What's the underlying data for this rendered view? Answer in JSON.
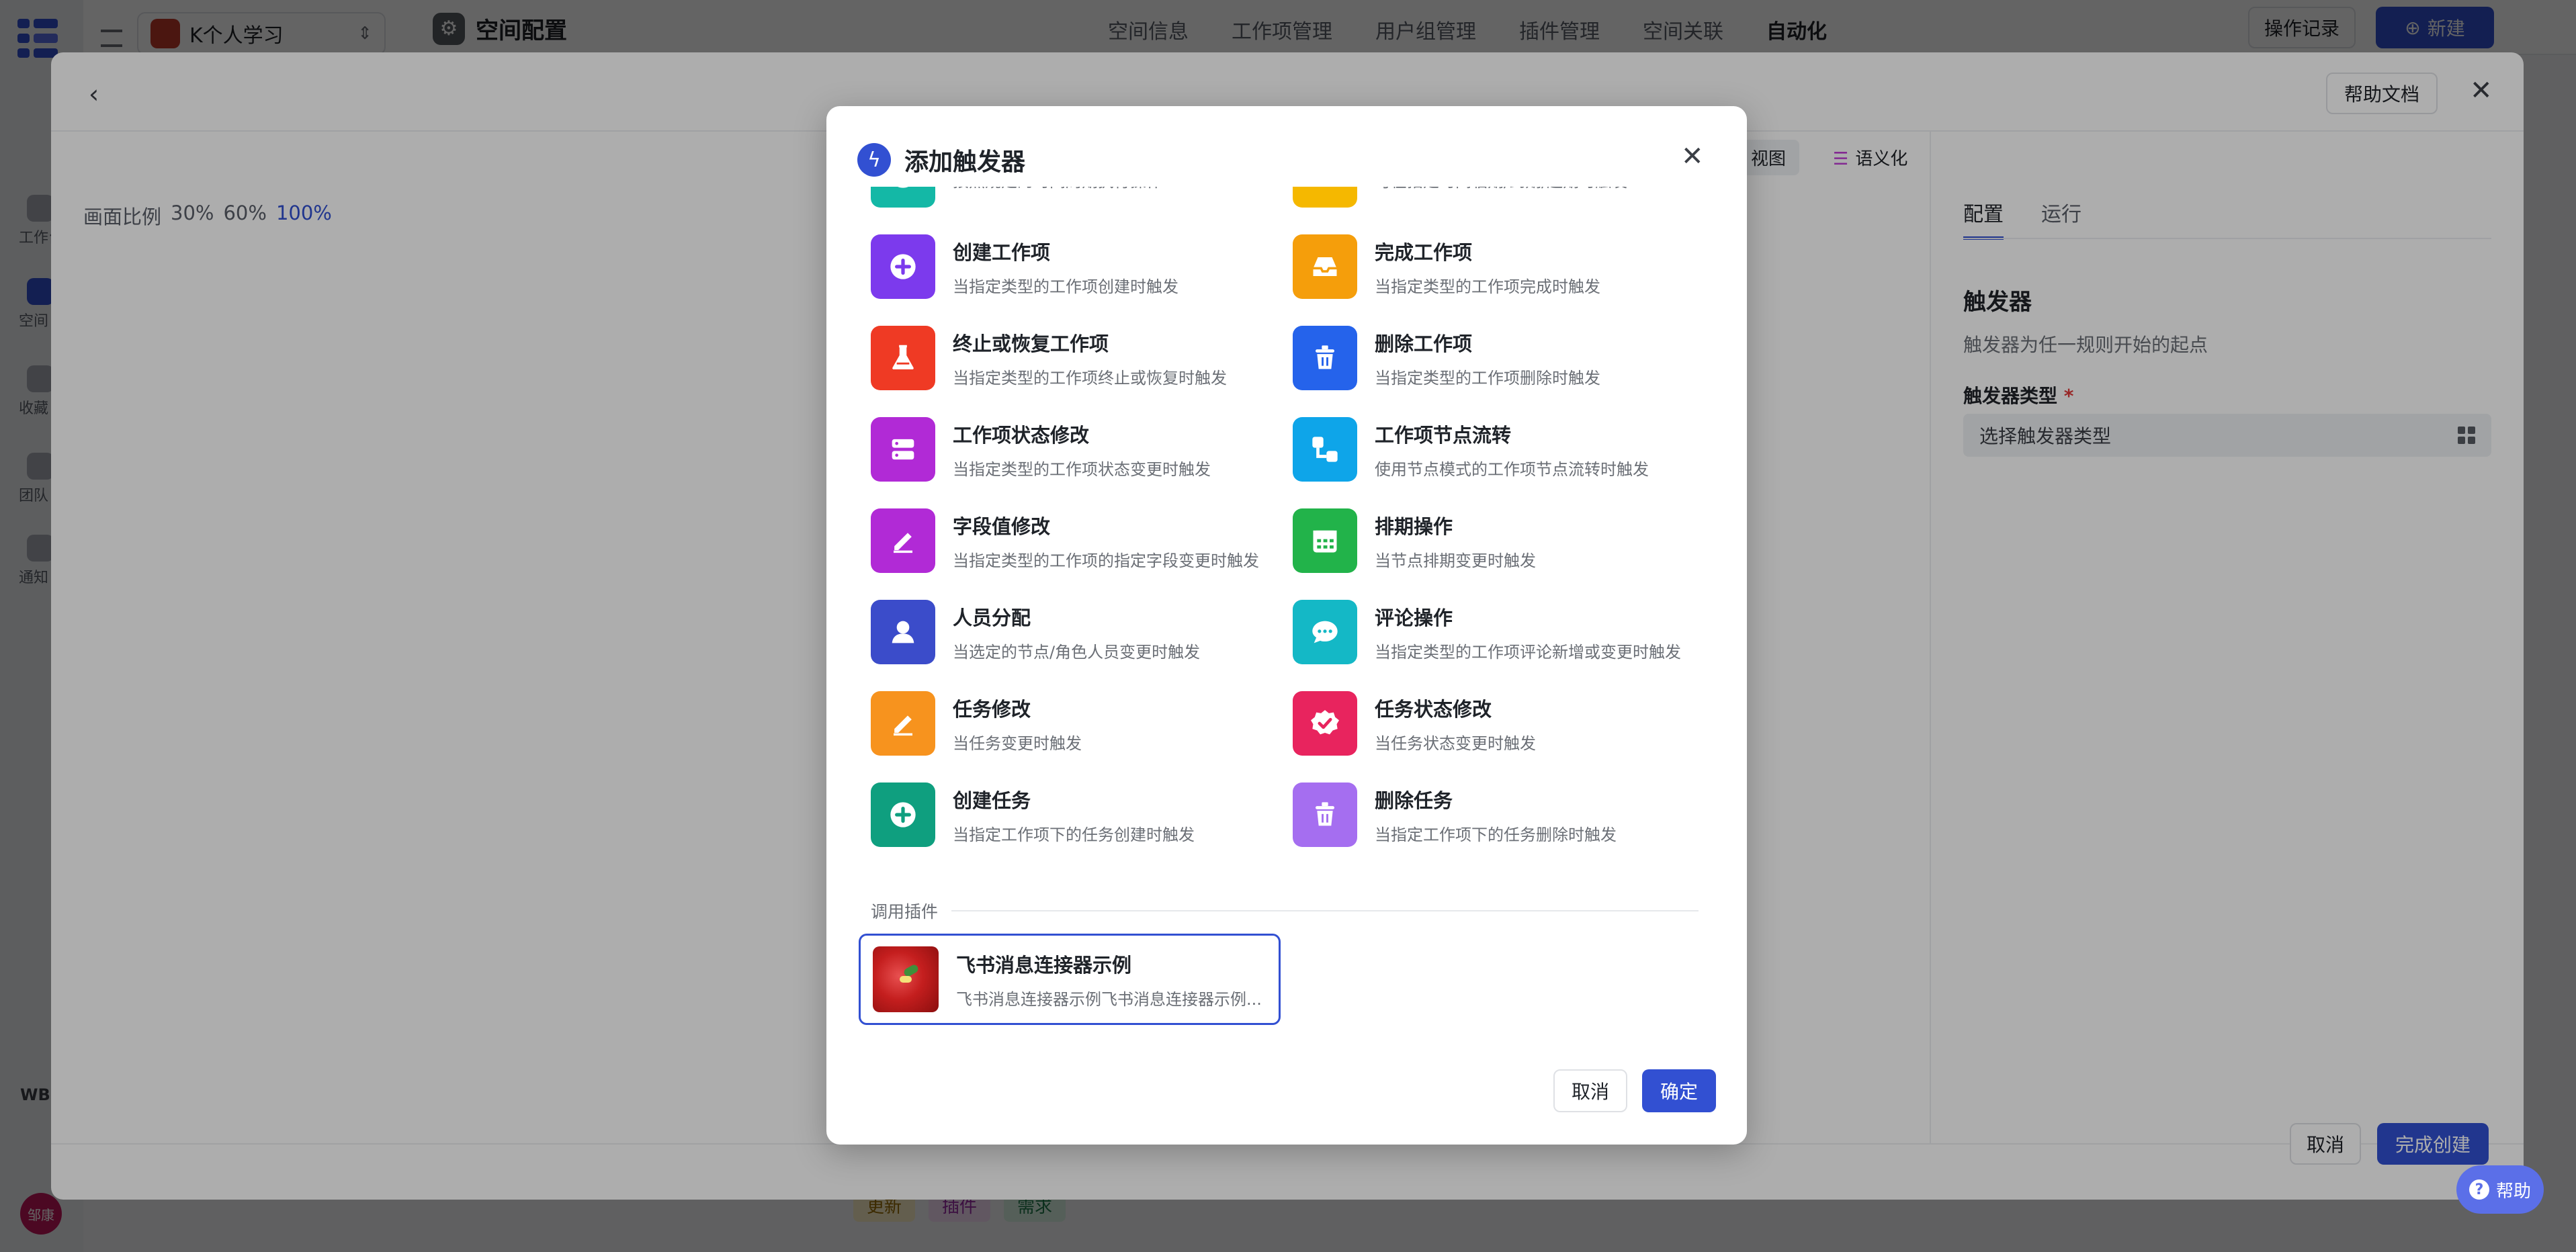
{
  "app": {
    "space_name": "K个人学习",
    "page_title": "空间配置",
    "nav_tabs": [
      "空间信息",
      "工作项管理",
      "用户组管理",
      "插件管理",
      "空间关联",
      "自动化"
    ],
    "active_nav_tab": "自动化",
    "oplog_label": "操作记录",
    "new_label": "新建",
    "sidebar_items": [
      "工作台",
      "空间",
      "收藏",
      "团队",
      "通知"
    ],
    "sidebar_bottom_badge": "WB",
    "user_avatar_text": "邹康",
    "bottom_tags": [
      "更新",
      "插件",
      "需求"
    ]
  },
  "drawer": {
    "help_doc_label": "帮助文档",
    "ratio_label": "画面比例",
    "ratios": [
      "30%",
      "60%",
      "100%"
    ],
    "selected_ratio": "100%",
    "view_tabs": [
      "视图",
      "语义化"
    ],
    "panel_tabs": [
      "配置",
      "运行"
    ],
    "active_panel_tab": "配置",
    "section_title": "触发器",
    "section_desc": "触发器为任一规则开始的起点",
    "trigger_type_label": "触发器类型",
    "required_mark": "*",
    "trigger_type_placeholder": "选择触发器类型",
    "cancel_label": "取消",
    "finish_label": "完成创建",
    "help_label": "帮助"
  },
  "modal": {
    "title": "添加触发器",
    "triggers": [
      {
        "id": "scheduled",
        "title": "",
        "desc": "按照规定的时间周期执行操作",
        "color": "#14b8a6",
        "icon": "clock-icon"
      },
      {
        "id": "deadline",
        "title": "",
        "desc": "可在指定时间临期/到期/超期时触发",
        "color": "#f5b800",
        "icon": "calendar-alarm-icon"
      },
      {
        "id": "create-item",
        "title": "创建工作项",
        "desc": "当指定类型的工作项创建时触发",
        "color": "#7c3aed",
        "icon": "plus-circle-icon"
      },
      {
        "id": "complete-item",
        "title": "完成工作项",
        "desc": "当指定类型的工作项完成时触发",
        "color": "#f59e0b",
        "icon": "inbox-icon"
      },
      {
        "id": "terminate-item",
        "title": "终止或恢复工作项",
        "desc": "当指定类型的工作项终止或恢复时触发",
        "color": "#ef3a24",
        "icon": "flask-icon"
      },
      {
        "id": "delete-item",
        "title": "删除工作项",
        "desc": "当指定类型的工作项删除时触发",
        "color": "#2563eb",
        "icon": "trash-icon"
      },
      {
        "id": "status-change",
        "title": "工作项状态修改",
        "desc": "当指定类型的工作项状态变更时触发",
        "color": "#b12ad6",
        "icon": "status-icon"
      },
      {
        "id": "node-flow",
        "title": "工作项节点流转",
        "desc": "使用节点模式的工作项节点流转时触发",
        "color": "#0ea5e9",
        "icon": "flow-icon"
      },
      {
        "id": "field-change",
        "title": "字段值修改",
        "desc": "当指定类型的工作项的指定字段变更时触发",
        "color": "#b12ad6",
        "icon": "pencil-icon"
      },
      {
        "id": "schedule-op",
        "title": "排期操作",
        "desc": "当节点排期变更时触发",
        "color": "#22b34a",
        "icon": "calendar-icon"
      },
      {
        "id": "assign",
        "title": "人员分配",
        "desc": "当选定的节点/角色人员变更时触发",
        "color": "#3b4cca",
        "icon": "user-icon"
      },
      {
        "id": "comment",
        "title": "评论操作",
        "desc": "当指定类型的工作项评论新增或变更时触发",
        "color": "#14b8c6",
        "icon": "comment-icon"
      },
      {
        "id": "task-change",
        "title": "任务修改",
        "desc": "当任务变更时触发",
        "color": "#f7931e",
        "icon": "pencil-icon"
      },
      {
        "id": "task-status",
        "title": "任务状态修改",
        "desc": "当任务状态变更时触发",
        "color": "#e8245e",
        "icon": "badge-check-icon"
      },
      {
        "id": "create-task",
        "title": "创建任务",
        "desc": "当指定工作项下的任务创建时触发",
        "color": "#0f9f7f",
        "icon": "plus-circle-icon"
      },
      {
        "id": "delete-task",
        "title": "删除任务",
        "desc": "当指定工作项下的任务删除时触发",
        "color": "#a56ef0",
        "icon": "trash-icon"
      }
    ],
    "plugin_section_label": "调用插件",
    "plugin": {
      "title": "飞书消息连接器示例",
      "desc": "飞书消息连接器示例飞书消息连接器示例..."
    },
    "cancel_label": "取消",
    "ok_label": "确定"
  },
  "colors": {
    "accent": "#3250d2",
    "modal_bg": "#ffffff"
  }
}
